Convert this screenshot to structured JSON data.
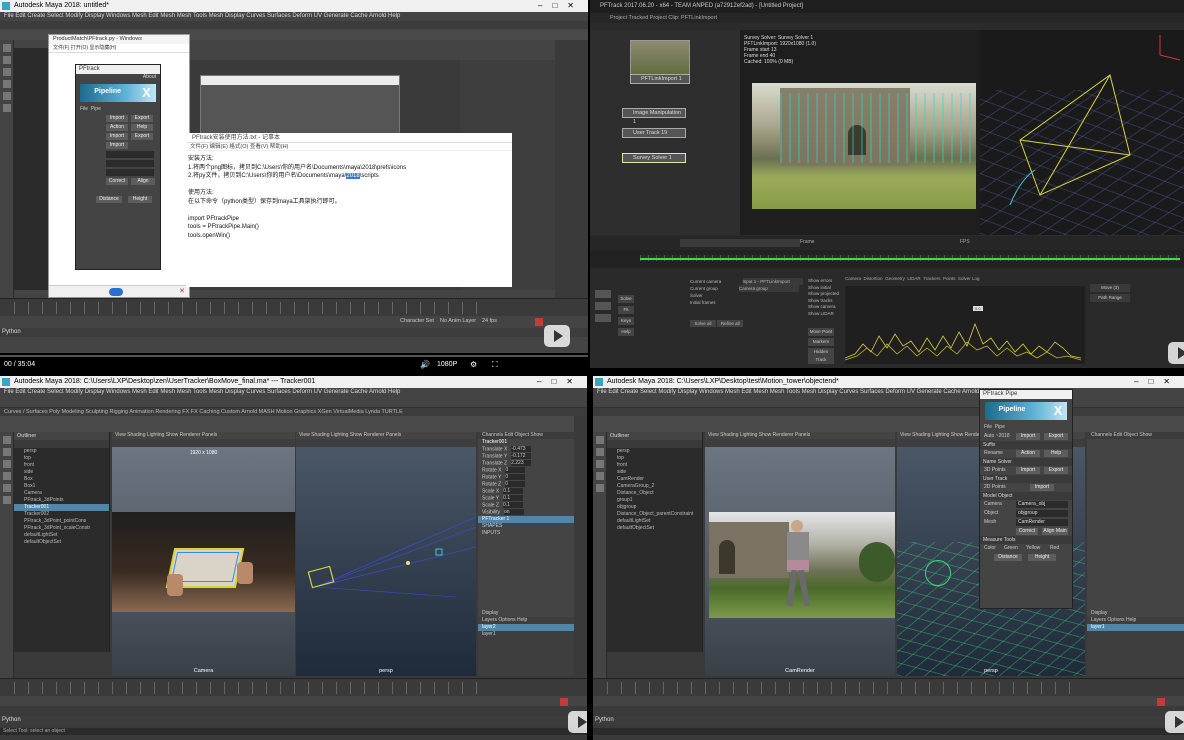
{
  "q1": {
    "title": "Autodesk Maya 2018: untitled*",
    "menu": "File  Edit  Create  Select  Modify  Display  Windows  Mesh  Edit Mesh  Mesh Tools  Mesh Display  Curves  Surfaces  Deform  UV  Generate  Cache  Arnold  Help",
    "explorer_title": "ProductMatch\\PFtrack.py - Windows",
    "plugin_title": "PFtrack",
    "plugin_about": "About",
    "plugin_logo": "Pipeline",
    "plugin_menu": [
      "File",
      "Pipe"
    ],
    "notepad_title": "PFtrack安装使用方法.txt - 记事本",
    "notepad_menu": "文件(F)  编辑(E)  格式(O)  查看(V)  帮助(H)",
    "notepad_lines": [
      "安装方法:",
      "1.将两个png图标，拷贝到C:\\Users\\你的用户名\\Documents\\maya\\2018\\prefs\\icons",
      "",
      "2.将py文件，拷贝到C:\\Users\\你的用户名\\Documents\\maya\\",
      "",
      "使用方法:",
      "在以下命令（python类型）保存到maya工具架执行即可。",
      "",
      "import PFtrackPipe",
      "tools = PFtrackPipe.Main()",
      "tools.openWin()"
    ],
    "notepad_highlight": "2018",
    "notepad_line4_suffix": "\\scripts",
    "video_time": "00 / 35:04",
    "quality": "1080P",
    "range": "Character Set",
    "no_anim": "No Anim Layer",
    "fps": "24 fps",
    "cmd": "Python"
  },
  "q2": {
    "title": "PFTrack 2017.06.20 - x64 - TEAM ANPED (a72912ef2ad) - [Untitled Project]",
    "menu": "Project  Tracked Project  Clip: PFTLinkImport",
    "nodes": [
      "PFTLinkImport 1",
      "Image Manipulation 1",
      "User Track 19",
      "Survey Solver 1"
    ],
    "info": [
      "Survey Solver: Survey Solver 1",
      "PFTLinkImport: 1920x1080 (1.0)",
      "Frame start 13",
      "Frame end 40",
      "Cached: 100% (0 MB)"
    ],
    "panel_tabs": [
      "Camera",
      "Distortion",
      "Geometry",
      "LIDAR",
      "Trackers",
      "Points",
      "Solver Log"
    ],
    "panel_labels": [
      "Current camera",
      "Current group",
      "Solver",
      "Initial frames",
      "Solve all",
      "Refine all"
    ],
    "camera_value": "Input 1 - PFTLinkImport",
    "group_value": "Camera group",
    "checkboxes": [
      "Show errors",
      "Show initial",
      "Show projected",
      "Show tracks",
      "Show camera",
      "Show LIDAR"
    ],
    "side_buttons": [
      "Solve",
      "Fit",
      "Keys",
      "Help"
    ],
    "right_buttons": [
      "Move Point",
      "Markers",
      "Hidden Track"
    ],
    "graph_label": "0.0",
    "mini": [
      "Frame",
      "FPS"
    ],
    "right_pane": [
      "Move (3)",
      "Path Range"
    ]
  },
  "q3": {
    "title": "Autodesk Maya 2018: C:\\Users\\LXP\\Desktop\\zen\\UserTracker\\BoxMove_final.ma*  ---  Tracker001",
    "menu": "File  Edit  Create  Select  Modify  Display  Windows  Mesh  Edit Mesh  Mesh Tools  Mesh Display  Curves  Surfaces  Deform  UV  Generate  Cache  Arnold  Help",
    "shelf_tabs": "Curves / Surfaces  Poly Modeling  Sculpting  Rigging  Animation  Rendering  FX  FX Caching  Custom  Arnold  MASH  Motion Graphics  XGen  VirtualMedia  Lynda  TURTLE",
    "outliner": {
      "header": "Outliner",
      "items": [
        "persp",
        "top",
        "front",
        "side",
        "Box",
        "Box1",
        "Camera",
        "PFtrack_3dPoints",
        "Tracker001",
        "Tracker002",
        "PFtrack_3dPoint_pointCons",
        "PFtrack_3dPoint_scaleConstr",
        "defaultLightSet",
        "defaultObjectSet"
      ],
      "selected": 8
    },
    "vp_left_label": "Camera",
    "vp_right_label": "persp",
    "resolution": "1920 x 1080",
    "channels": [
      "Translate X",
      "Translate Y",
      "Translate Z",
      "Rotate X",
      "Rotate Y",
      "Rotate Z",
      "Scale X",
      "Scale Y",
      "Scale Z",
      "Visibility"
    ],
    "channel_values": [
      "-0.473",
      "-0.172",
      "2.223",
      "0",
      "0",
      "0",
      "0.1",
      "0.1",
      "0.1",
      "on"
    ],
    "shapes": "SHAPES",
    "inputs": "INPUTS",
    "display_tab": "Display",
    "layer_names": [
      "layer2",
      "layer1"
    ],
    "cmd": "Python",
    "help": "Select Tool: select an object"
  },
  "q4": {
    "title": "Autodesk Maya 2018: C:\\Users\\LXP\\Desktop\\test\\Motion_tower\\objectend*",
    "menu": "File  Edit  Create  Select  Modify  Display  Windows  Mesh  Edit Mesh  Mesh Tools  Mesh Display  Curves  Surfaces  Deform  UV  Generate  Cache  Arnold  Help",
    "plugin_title": "PFtrack Pipe",
    "plugin_logo": "Pipeline",
    "plugin_menu": [
      "File",
      "Pipe"
    ],
    "plugin_rows": [
      {
        "label": "Auto ~2018",
        "btn1": "Import",
        "btn2": "Export"
      },
      {
        "label": "Rename",
        "btn1": "Action",
        "btn2": "Help"
      },
      {
        "label": "3D Points",
        "btn1": "Import",
        "btn2": "Export"
      },
      {
        "label": "2D Points",
        "btn1": "Import",
        "btn2": ""
      }
    ],
    "plugin_sections": [
      "Suffix",
      "Name",
      "Solver",
      "User",
      "Track",
      "Model",
      "Object"
    ],
    "fields": [
      {
        "label": "Camera",
        "value": "Camera_obj"
      },
      {
        "label": "Object",
        "value": "objgroup"
      },
      {
        "label": "Mesh",
        "value": "CamRender"
      }
    ],
    "plugin_buttons": [
      "Correct",
      "Align Main"
    ],
    "measure": "Measure",
    "measure_tools": "Tools",
    "colors": [
      "Green",
      "Yellow",
      "Red"
    ],
    "bottom_buttons": [
      "Distance",
      "Height"
    ],
    "outliner": {
      "header": "Outliner",
      "items": [
        "persp",
        "top",
        "front",
        "side",
        "CamRender",
        "CameraGroup_2",
        "Distance_Object",
        "group1",
        "objgroup",
        "Distance_Object_parentConstraint",
        "defaultLightSet",
        "defaultObjectSet"
      ]
    },
    "vp_left_label": "CamRender",
    "vp_right_label": "persp",
    "channel_header": [
      "Channels",
      "Edit",
      "Object",
      "Show"
    ],
    "display_tab": "Display",
    "layer_names": [
      "layer1"
    ],
    "cmd": "Python"
  }
}
